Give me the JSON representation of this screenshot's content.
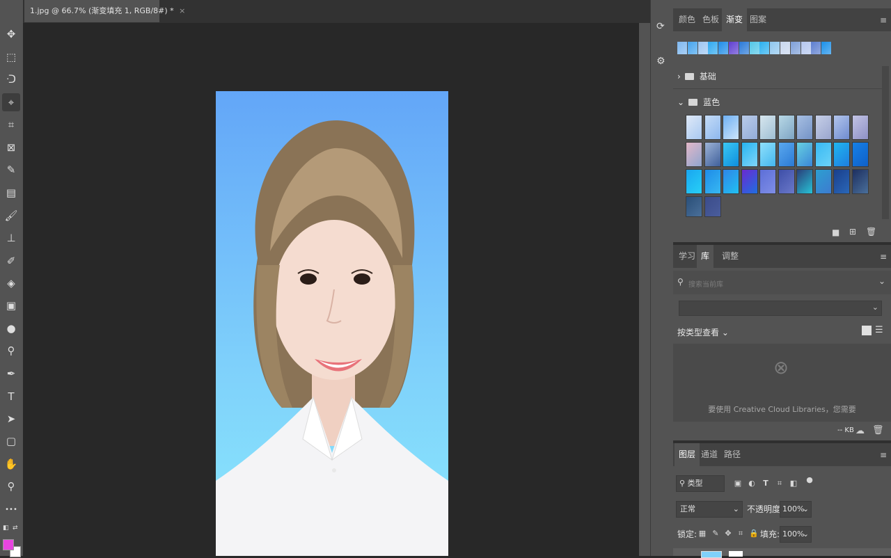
{
  "document": {
    "tab_title": "1.jpg @ 66.7% (渐变填充 1, RGB/8#) *",
    "close_glyph": "×"
  },
  "tools": [
    {
      "name": "move-tool-icon",
      "glyph": "✥"
    },
    {
      "name": "marquee-tool-icon",
      "glyph": "⬚"
    },
    {
      "name": "lasso-tool-icon",
      "glyph": "ᑝ"
    },
    {
      "name": "quick-select-tool-icon",
      "glyph": "⌖"
    },
    {
      "name": "crop-tool-icon",
      "glyph": "⌗"
    },
    {
      "name": "frame-tool-icon",
      "glyph": "⊠"
    },
    {
      "name": "eyedropper-tool-icon",
      "glyph": "✎"
    },
    {
      "name": "healing-brush-tool-icon",
      "glyph": "▤"
    },
    {
      "name": "brush-tool-icon",
      "glyph": "🖌"
    },
    {
      "name": "clone-stamp-tool-icon",
      "glyph": "⊥"
    },
    {
      "name": "history-brush-tool-icon",
      "glyph": "✐"
    },
    {
      "name": "eraser-tool-icon",
      "glyph": "◈"
    },
    {
      "name": "gradient-tool-icon",
      "glyph": "▣"
    },
    {
      "name": "blur-tool-icon",
      "glyph": "●"
    },
    {
      "name": "dodge-tool-icon",
      "glyph": "⚲"
    },
    {
      "name": "pen-tool-icon",
      "glyph": "✒"
    },
    {
      "name": "type-tool-icon",
      "glyph": "T"
    },
    {
      "name": "path-select-tool-icon",
      "glyph": "➤"
    },
    {
      "name": "rectangle-tool-icon",
      "glyph": "▢"
    },
    {
      "name": "hand-tool-icon",
      "glyph": "✋"
    },
    {
      "name": "zoom-tool-icon",
      "glyph": "⚲"
    },
    {
      "name": "more-tools-icon",
      "glyph": "•••"
    }
  ],
  "colors": {
    "foreground": "#e845e0",
    "background": "#ffffff",
    "accent_canvas_top": "#63a6f8",
    "accent_canvas_bottom": "#8ae8fc"
  },
  "gradients_panel": {
    "tabs": [
      "颜色",
      "色板",
      "渐变",
      "图案"
    ],
    "selected_tab": "渐变",
    "folders": [
      {
        "label": "基础",
        "expanded": false
      },
      {
        "label": "蓝色",
        "expanded": true
      }
    ]
  },
  "library_panel": {
    "tabs": [
      "学习",
      "库",
      "调整"
    ],
    "selected_tab": "库",
    "search_placeholder": "搜索当前库",
    "view_label": "按类型查看",
    "message": "要使用 Creative Cloud Libraries，您需要",
    "size_label": "-- KB"
  },
  "layers_panel": {
    "tabs": [
      "图层",
      "通道",
      "路径"
    ],
    "selected_tab": "图层",
    "filter_label": "类型",
    "blend_mode": "正常",
    "opacity_label": "不透明度:",
    "opacity_value": "100%",
    "lock_label": "锁定:",
    "fill_label": "填充:",
    "fill_value": "100%"
  }
}
